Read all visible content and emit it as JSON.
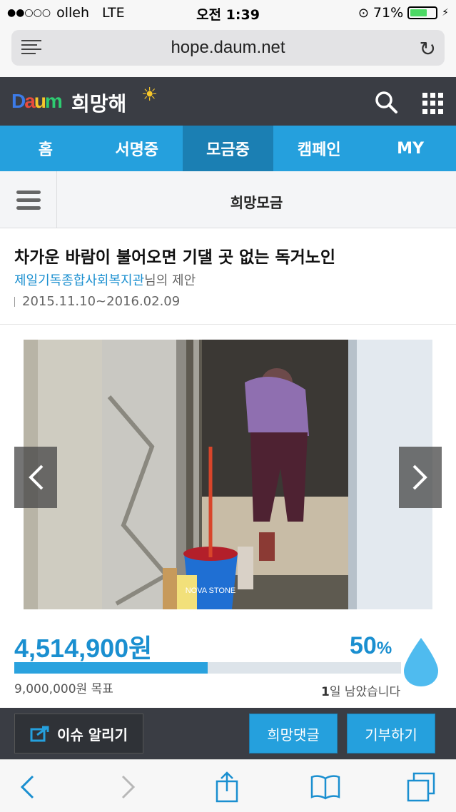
{
  "status": {
    "carrier": "olleh",
    "network": "LTE",
    "time": "오전 1:39",
    "battery": "71%",
    "battery_level": 0.71
  },
  "browser": {
    "url": "hope.daum.net"
  },
  "header": {
    "logo": "Daum",
    "brand": "희망해"
  },
  "nav": {
    "tabs": [
      "홈",
      "서명중",
      "모금중",
      "캠페인",
      "MY"
    ],
    "active_index": 2
  },
  "subheader": {
    "title": "희망모금"
  },
  "campaign": {
    "title": "차가운 바람이 불어오면 기댈 곳 없는 독거노인",
    "organization": "제일기독종합사회복지관",
    "proposer_suffix": "님의 제안",
    "period": "2015.11.10~2016.02.09"
  },
  "funding": {
    "amount": "4,514,900원",
    "percent_number": "50",
    "percent_sign": "%",
    "progress": 0.5,
    "goal": "9,000,000원 목표",
    "days_number": "1",
    "days_suffix": "일 남았습니다"
  },
  "actions": {
    "share": "이슈 알리기",
    "comment": "희망댓글",
    "donate": "기부하기"
  },
  "colors": {
    "accent": "#25a0dd",
    "dark_header": "#3a3d44",
    "active_tab": "#1b7fb3"
  }
}
